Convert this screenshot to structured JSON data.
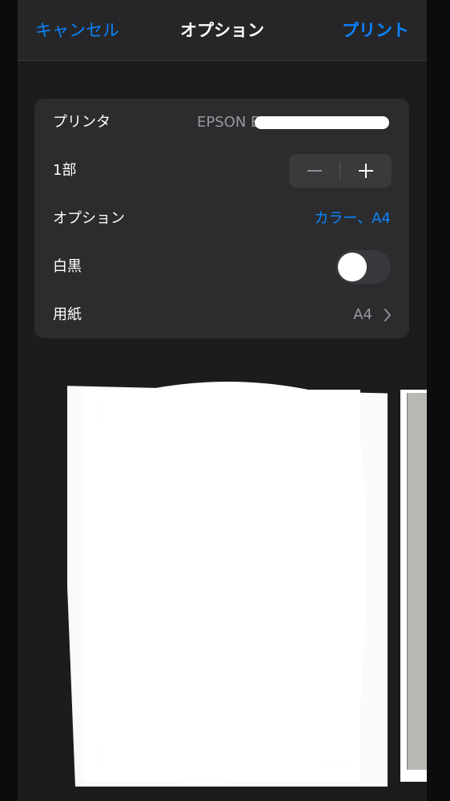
{
  "nav": {
    "cancel_label": "キャンセル",
    "title": "オプション",
    "print_label": "プリント"
  },
  "settings": {
    "printer_label": "プリンタ",
    "printer_value": "EPSON EP",
    "copies_label": "1部",
    "options_label": "オプション",
    "options_value": "カラー、A4",
    "bw_label": "白黒",
    "bw_on": false,
    "paper_label": "用紙",
    "paper_value": "A4"
  },
  "icons": {
    "minus": "minus-icon",
    "plus": "plus-icon",
    "chevron": "chevron-right-icon"
  },
  "colors": {
    "accent": "#0a84ff",
    "background": "#1c1c1e",
    "card": "#2c2c2e"
  }
}
